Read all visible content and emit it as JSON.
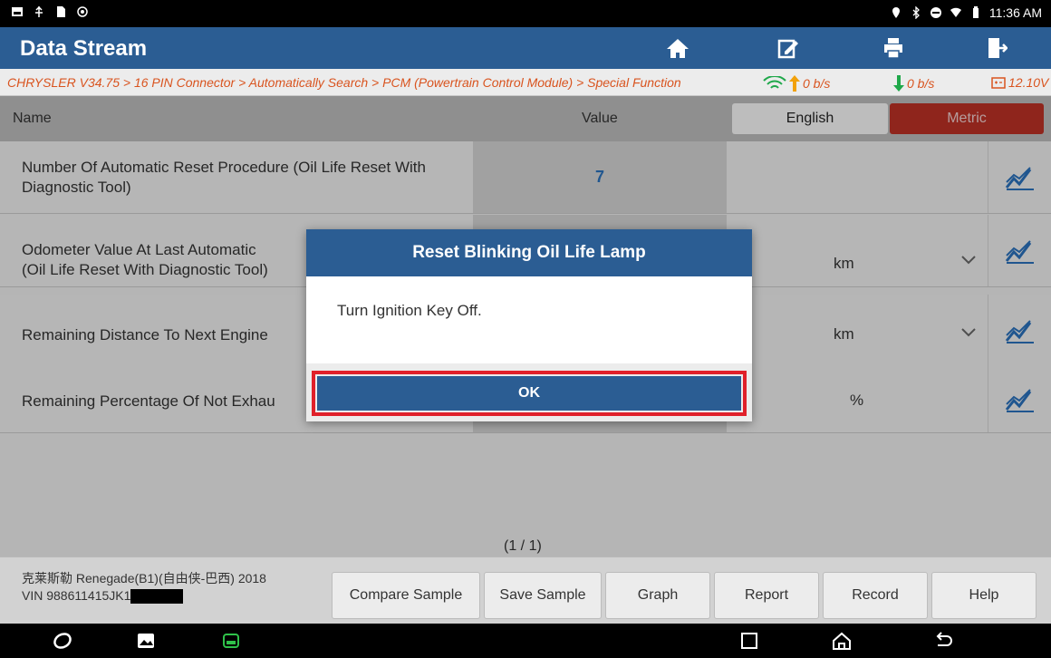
{
  "statusbar": {
    "time": "11:36 AM"
  },
  "titlebar": {
    "title": "Data Stream"
  },
  "crumb": {
    "path": "CHRYSLER V34.75 > 16 PIN Connector > Automatically Search > PCM (Powertrain Control Module) > Special Function",
    "upload": "0 b/s",
    "download": "0 b/s",
    "voltage": "12.10V"
  },
  "columns": {
    "name": "Name",
    "value": "Value",
    "english": "English",
    "metric": "Metric"
  },
  "rows": [
    {
      "label": "Number Of Automatic Reset Procedure (Oil Life Reset With Diagnostic Tool)",
      "value": "7",
      "unit": ""
    },
    {
      "label": "Odometer Value At Last Automatic",
      "label2": "(Oil Life Reset With Diagnostic Tool)",
      "value": "",
      "unit": "km"
    },
    {
      "label": "Remaining Distance To Next Engine",
      "value": "",
      "unit": "km"
    },
    {
      "label": "Remaining Percentage Of Not Exhau",
      "value": "",
      "unit": "%"
    }
  ],
  "pager": "(1 / 1)",
  "footer": {
    "vehicle": "克莱斯勒 Renegade(B1)(自由侠-巴西) 2018",
    "vin": "VIN 988611415JK1",
    "buttons": [
      "Compare Sample",
      "Save Sample",
      "Graph",
      "Report",
      "Record",
      "Help"
    ]
  },
  "dialog": {
    "title": "Reset Blinking Oil Life Lamp",
    "message": "Turn Ignition Key Off.",
    "ok": "OK"
  },
  "colors": {
    "header_blue": "#2b5d93",
    "metric_red": "#b83025",
    "highlight_red": "#e0202a",
    "crumb_orange": "#d9541f"
  }
}
